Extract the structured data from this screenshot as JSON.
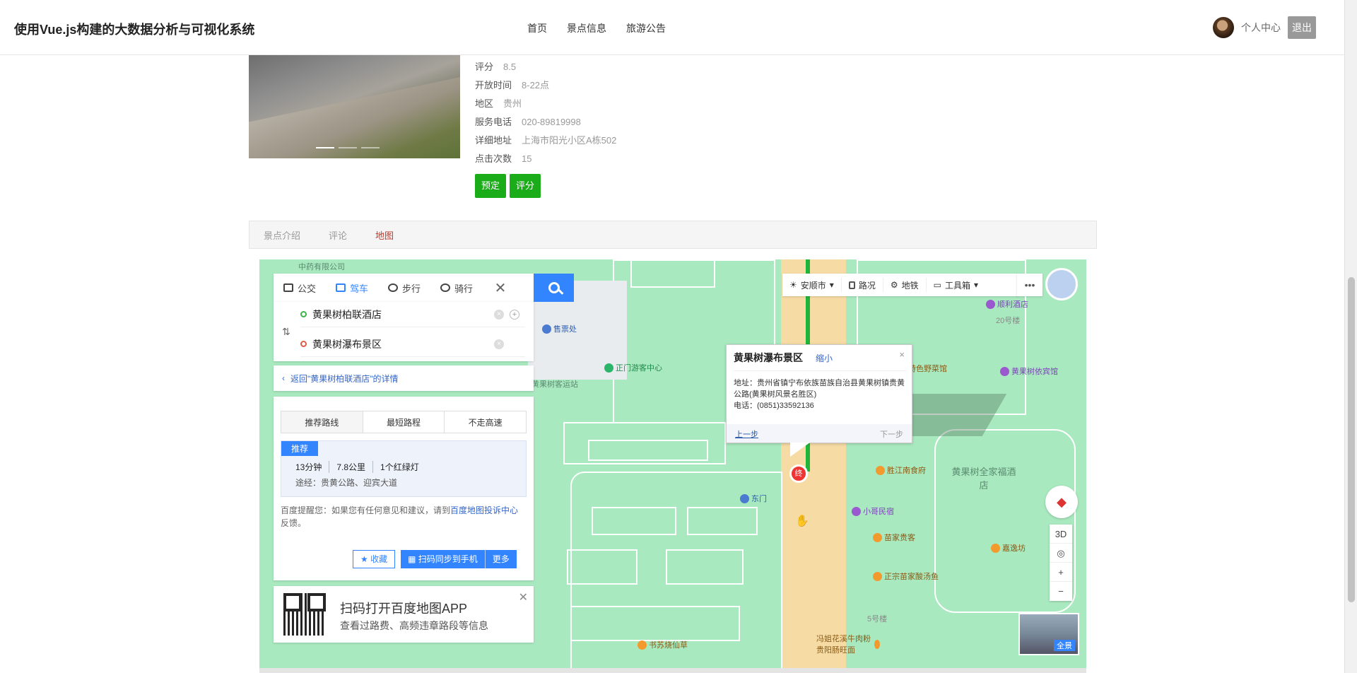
{
  "header": {
    "brand": "使用Vue.js构建的大数据分析与可视化系统",
    "nav": [
      "首页",
      "景点信息",
      "旅游公告"
    ],
    "user_center": "个人中心",
    "logout": "退出"
  },
  "detail": {
    "rows": [
      {
        "k": "评分",
        "v": "8.5"
      },
      {
        "k": "开放时间",
        "v": "8-22点"
      },
      {
        "k": "地区",
        "v": "贵州"
      },
      {
        "k": "服务电话",
        "v": "020-89819998"
      },
      {
        "k": "详细地址",
        "v": "上海市阳光小区A栋502"
      },
      {
        "k": "点击次数",
        "v": "15"
      }
    ],
    "book_label": "预定",
    "rate_label": "评分"
  },
  "tabs": [
    "景点介绍",
    "评论",
    "地图"
  ],
  "map": {
    "modes": [
      "公交",
      "驾车",
      "步行",
      "骑行"
    ],
    "close_x": "✕",
    "swap": "⇅",
    "start": "黄果树柏联酒店",
    "end": "黄果树瀑布景区",
    "back": "返回\"黄果树柏联酒店\"的详情",
    "plan_tabs": [
      "推荐路线",
      "最短路程",
      "不走高速"
    ],
    "rec_tag": "推荐",
    "plan": {
      "time": "13分钟",
      "distance": "7.8公里",
      "lights": "1个红绿灯"
    },
    "via": "途经：贵黄公路、迎宾大道",
    "tip_prefix": "百度提醒您：如果您有任何意见和建议，请到",
    "tip_link": "百度地图投诉中心",
    "tip_suffix": "反馈。",
    "fav": "★ 收藏",
    "sync": "▦ 扫码同步到手机",
    "more": "更多",
    "qr_title": "扫码打开百度地图APP",
    "qr_sub": "查看过路费、高频违章路段等信息",
    "toolbar": {
      "city": "安顺市",
      "traffic": "路况",
      "subway": "地铁",
      "tools": "工具箱"
    },
    "popup": {
      "title": "黄果树瀑布景区",
      "zoom": "缩小",
      "close": "×",
      "address": "地址：贵州省镇宁布依族苗族自治县黄果树镇贵黄公路(黄果树风景名胜区)",
      "phone": "电话：(0851)33592136",
      "prev": "上一步",
      "next": "下一步"
    },
    "end_pin": "终",
    "zoom_ctl": [
      "3D",
      "◎",
      "+",
      "−"
    ],
    "pano": "全景",
    "pois": [
      {
        "name": "售票处",
        "cls": "blue"
      },
      {
        "name": "正门游客中心",
        "cls": "green"
      },
      {
        "name": "黄果树客运站",
        "cls": ""
      },
      {
        "name": "东门",
        "cls": "blue"
      },
      {
        "name": "顺利酒店",
        "cls": "purple"
      },
      {
        "name": "20号楼",
        "cls": ""
      },
      {
        "name": "特色野菜馆",
        "cls": ""
      },
      {
        "name": "黄果树依宾馆",
        "cls": "purple"
      },
      {
        "name": "胜江南食府",
        "cls": ""
      },
      {
        "name": "小哥民宿",
        "cls": "purple"
      },
      {
        "name": "苗家贵客",
        "cls": ""
      },
      {
        "name": "嘉逸坊",
        "cls": ""
      },
      {
        "name": "正宗苗家酸汤鱼",
        "cls": ""
      },
      {
        "name": "5号楼",
        "cls": ""
      },
      {
        "name": "冯姐花溪牛肉粉贵阳肠旺面",
        "cls": ""
      },
      {
        "name": "书苏烧仙草",
        "cls": ""
      },
      {
        "name": "黄果树全家福酒店",
        "cls": ""
      },
      {
        "name": "中药有限公司",
        "cls": ""
      }
    ]
  }
}
